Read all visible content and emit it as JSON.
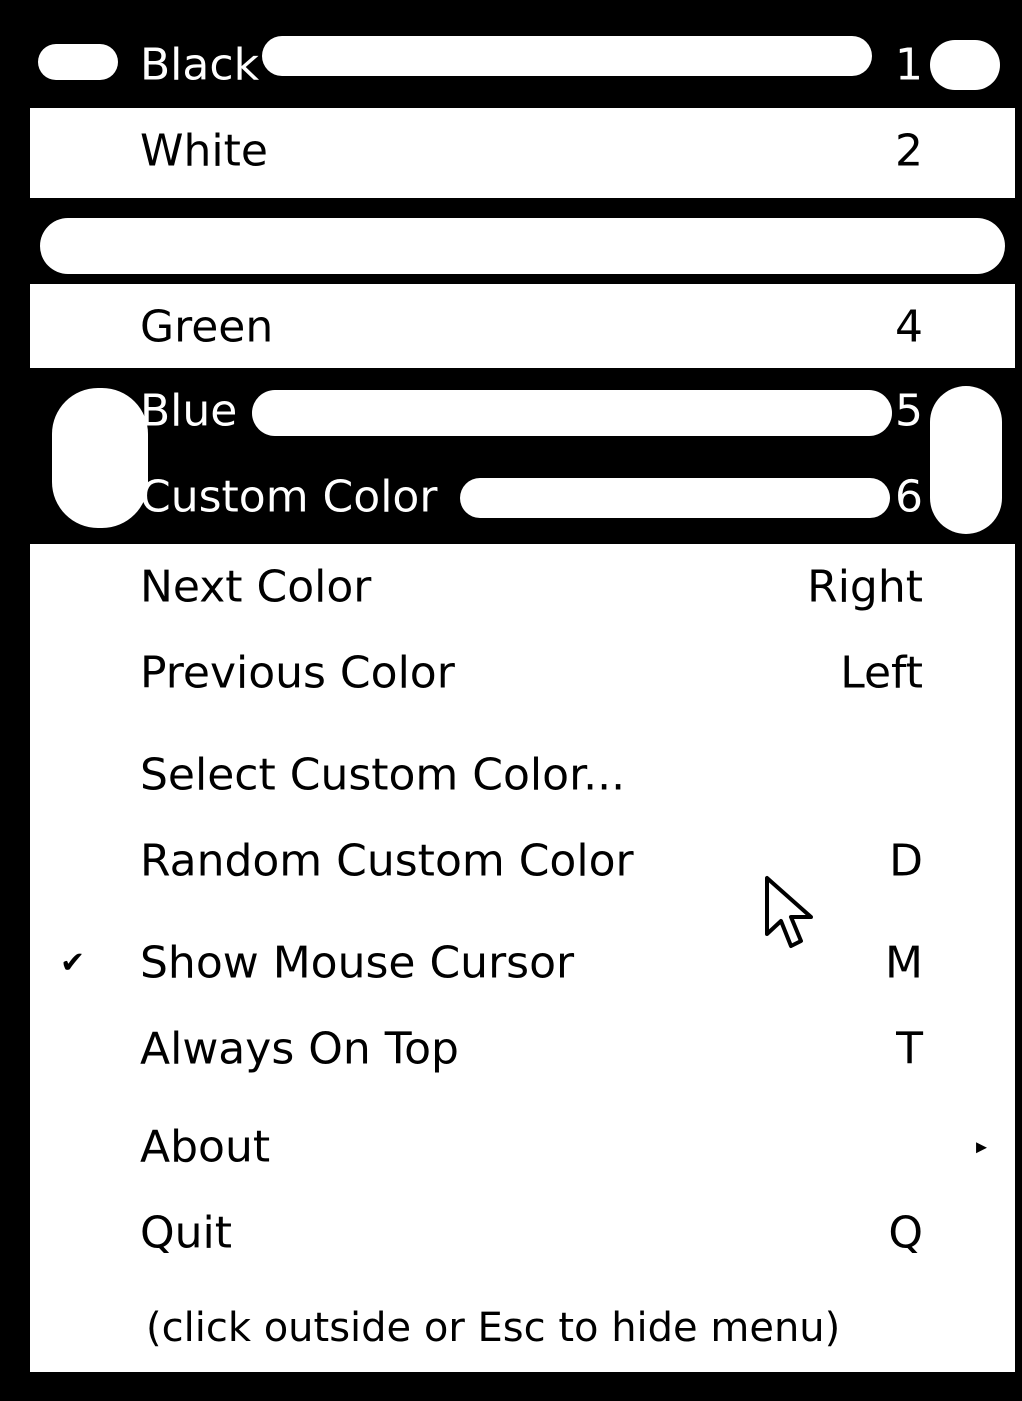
{
  "menu": {
    "colors": [
      {
        "label": "Black",
        "key": "1"
      },
      {
        "label": "White",
        "key": "2"
      },
      {
        "label": "",
        "key": ""
      },
      {
        "label": "Green",
        "key": "4"
      },
      {
        "label": "Blue",
        "key": "5"
      },
      {
        "label": "Custom Color",
        "key": "6"
      }
    ],
    "navigation": [
      {
        "label": "Next Color",
        "key": "Right"
      },
      {
        "label": "Previous Color",
        "key": "Left"
      }
    ],
    "custom": [
      {
        "label": "Select Custom Color...",
        "key": ""
      },
      {
        "label": "Random Custom Color",
        "key": "D"
      }
    ],
    "options": [
      {
        "label": "Show Mouse Cursor",
        "key": "M",
        "checked": true
      },
      {
        "label": "Always On Top",
        "key": "T",
        "checked": false
      }
    ],
    "about": {
      "label": "About",
      "submenu_icon": "triangle-right-icon"
    },
    "quit": {
      "label": "Quit",
      "key": "Q"
    },
    "hint": "(click outside or Esc to hide menu)"
  }
}
